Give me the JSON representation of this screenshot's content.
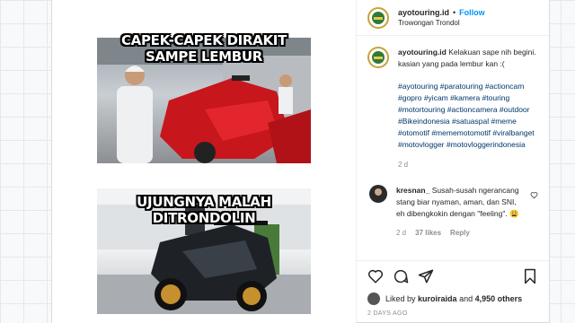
{
  "post": {
    "username": "ayotouring.id",
    "separator": "•",
    "follow_label": "Follow",
    "location": "Trowongan Trondol",
    "meme": {
      "caption_top": "CAPEK-CAPEK DIRAKIT\nSAMPE LEMBUR",
      "caption_bottom": "UJUNGNYA MALAH DITRONDOLIN"
    },
    "caption": {
      "username": "ayotouring.id",
      "text": "Kelakuan sape nih begini. kasian yang pada lembur kan :(",
      "hashtags": "#ayotouring #paratouring #actioncam #gopro #yicam #kamera #touring #motortouring #actioncamera #outdoor #Bikeindonesia #satuaspal #meme #otomotif #mememotomotif #viralbanget #motovlogger #motovloggerindonesia",
      "time": "2 d"
    },
    "comment": {
      "username": "kresnan_",
      "text": "Susah-susah ngerancang stang biar nyaman, aman, dan SNI, eh dibengkokin dengan \"feeling\". 😩",
      "time": "2 d",
      "likes": "37 likes",
      "reply_label": "Reply"
    },
    "likes": {
      "prefix": "Liked by",
      "user": "kuroiraida",
      "conj": "and",
      "count": "4,950 others"
    },
    "timestamp": "2 DAYS AGO"
  },
  "icons": {
    "like": "heart-icon",
    "comment": "comment-icon",
    "share": "share-icon",
    "save": "bookmark-icon"
  },
  "colors": {
    "accent": "#0095f6",
    "hashtag": "#00376b",
    "muted": "#8e8e8e"
  }
}
